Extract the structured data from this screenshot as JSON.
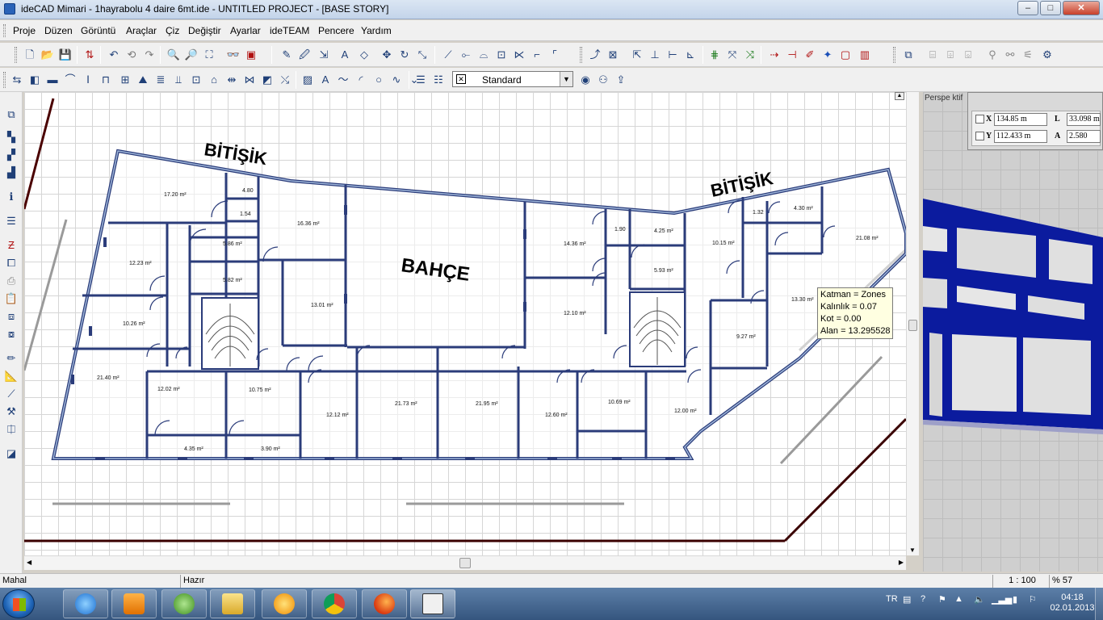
{
  "window": {
    "title": "ideCAD Mimari - 1hayrabolu 4 daire 6mt.ide - UNTITLED PROJECT - [BASE STORY]",
    "min_label": "–",
    "max_label": "□",
    "close_label": "✕"
  },
  "menu": [
    "Proje",
    "Düzen",
    "Görüntü",
    "Araçlar",
    "Çiz",
    "Değiştir",
    "Ayarlar",
    "ideTEAM",
    "Pencere",
    "Yardım"
  ],
  "toolbar": {
    "style_select": "Standard"
  },
  "plan": {
    "neighbor_label_left": "BİTİŞİK",
    "neighbor_label_right": "BİTİŞİK",
    "garden_label": "BAHÇE",
    "areas": [
      {
        "id": "a1",
        "text": "17.20 m²"
      },
      {
        "id": "a2",
        "text": "4.80"
      },
      {
        "id": "a3",
        "text": "1.54"
      },
      {
        "id": "a4",
        "text": "16.36 m²"
      },
      {
        "id": "a5",
        "text": "5.86 m²"
      },
      {
        "id": "a6",
        "text": "12.23 m²"
      },
      {
        "id": "a7",
        "text": "5.82 m²"
      },
      {
        "id": "a8",
        "text": "13.01 m²"
      },
      {
        "id": "a9",
        "text": "10.26 m²"
      },
      {
        "id": "a10",
        "text": "21.40 m²"
      },
      {
        "id": "a11",
        "text": "12.02 m²"
      },
      {
        "id": "a12",
        "text": "10.75 m²"
      },
      {
        "id": "a13",
        "text": "12.12 m²"
      },
      {
        "id": "a14",
        "text": "21.73 m²"
      },
      {
        "id": "a15",
        "text": "21.95 m²"
      },
      {
        "id": "a16",
        "text": "4.35 m²"
      },
      {
        "id": "a17",
        "text": "3.90 m²"
      },
      {
        "id": "a18",
        "text": "14.36 m²"
      },
      {
        "id": "a19",
        "text": "1.90"
      },
      {
        "id": "a20",
        "text": "4.25 m²"
      },
      {
        "id": "a21",
        "text": "10.15 m²"
      },
      {
        "id": "a22",
        "text": "1.32"
      },
      {
        "id": "a23",
        "text": "4.30 m²"
      },
      {
        "id": "a24",
        "text": "21.08 m²"
      },
      {
        "id": "a25",
        "text": "5.93 m²"
      },
      {
        "id": "a26",
        "text": "12.10 m²"
      },
      {
        "id": "a27",
        "text": "13.30 m²"
      },
      {
        "id": "a28",
        "text": "9.27 m²"
      },
      {
        "id": "a29",
        "text": "12.60 m²"
      },
      {
        "id": "a30",
        "text": "10.69 m²"
      },
      {
        "id": "a31",
        "text": "12.00 m²"
      }
    ]
  },
  "tooltip": {
    "line1": "Katman = Zones",
    "line2": "Kalınlık = 0.07",
    "line3": "Kot = 0.00",
    "line4": "Alan = 13.295528"
  },
  "perspective": {
    "label": "Perspe ktif"
  },
  "coords": {
    "x_label": "X",
    "x_value": "134.85 m",
    "l_label": "L",
    "l_value": "33.098 m",
    "y_label": "Y",
    "y_value": "112.433 m",
    "a_label": "A",
    "a_value": "2.580"
  },
  "status": {
    "left": "Mahal",
    "mid": "Hazır",
    "scale": "1 : 100",
    "zoom": "% 57"
  },
  "taskbar": {
    "lang": "TR",
    "time": "04:18",
    "date": "02.01.2013"
  },
  "colors": {
    "wall": "#2b3c7a",
    "wall_fill": "#9fb6d9",
    "persp_blue": "#0b1b9e"
  }
}
